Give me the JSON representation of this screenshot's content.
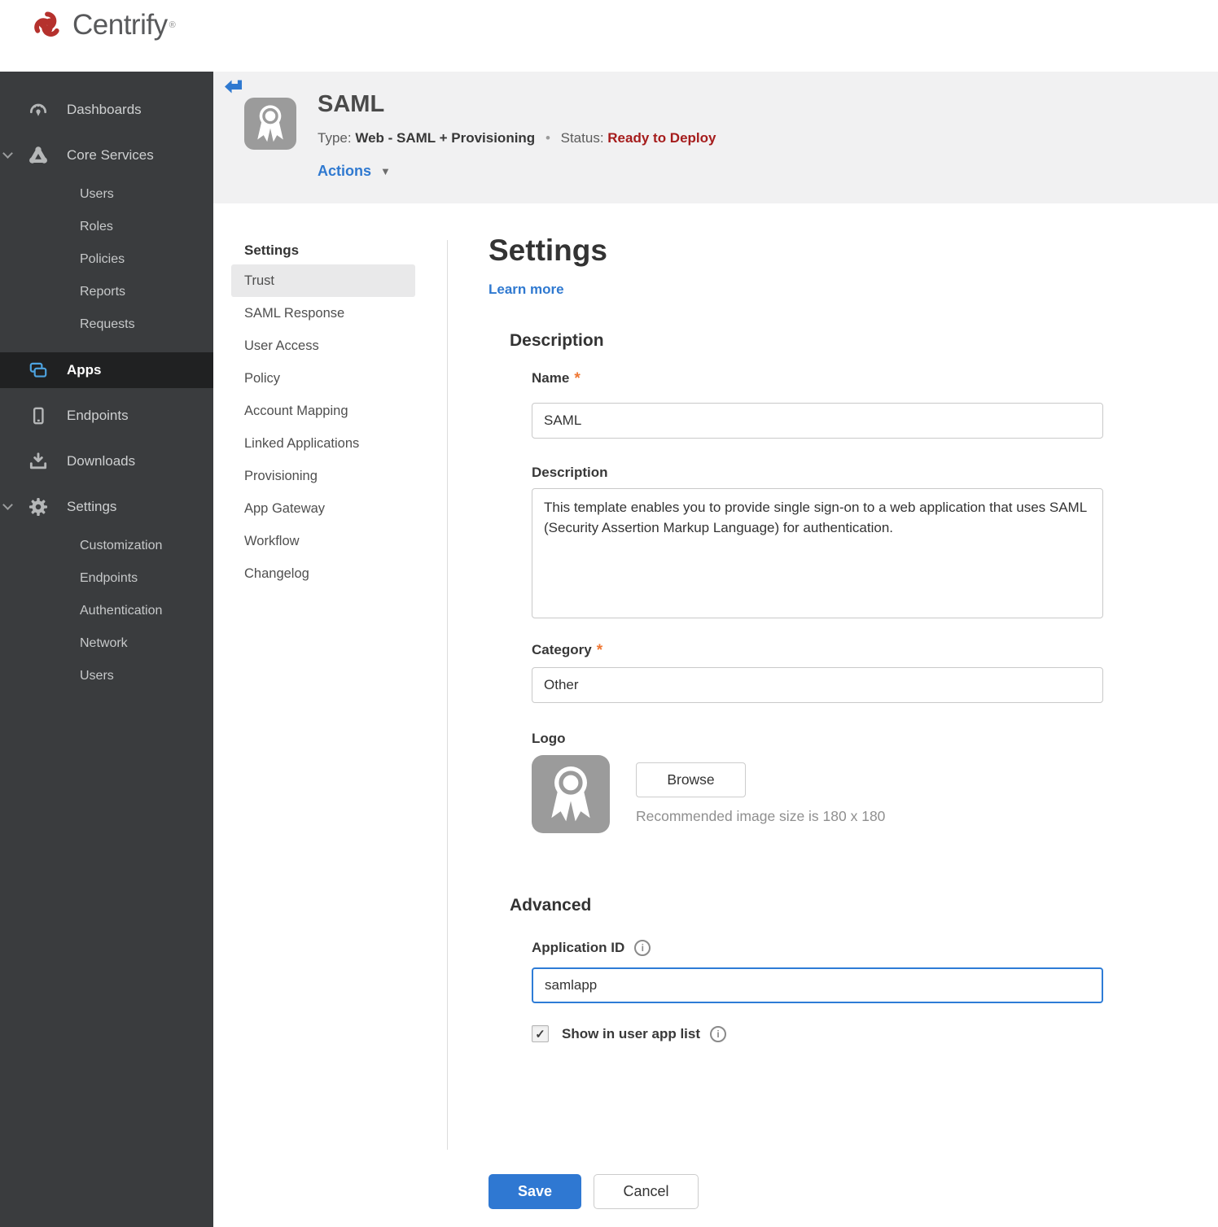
{
  "brand": {
    "name": "Centrify",
    "trademark": "®",
    "swirl_color": "#b5312d"
  },
  "icons": {
    "check": "✓",
    "dropdown_arrow": "▼",
    "separator_dot": "•",
    "required": "*",
    "info": "i"
  },
  "sidebar": {
    "items": [
      {
        "label": "Dashboards"
      },
      {
        "label": "Core Services",
        "expanded": true
      },
      {
        "label": "Users"
      },
      {
        "label": "Roles"
      },
      {
        "label": "Policies"
      },
      {
        "label": "Reports"
      },
      {
        "label": "Requests"
      },
      {
        "label": "Apps",
        "active": true
      },
      {
        "label": "Endpoints"
      },
      {
        "label": "Downloads"
      },
      {
        "label": "Settings",
        "expanded": true
      },
      {
        "label": "Customization"
      },
      {
        "label": "Endpoints"
      },
      {
        "label": "Authentication"
      },
      {
        "label": "Network"
      },
      {
        "label": "Users"
      }
    ]
  },
  "header": {
    "app_name": "SAML",
    "type_label": "Type:",
    "type_value": "Web - SAML + Provisioning",
    "status_label": "Status:",
    "status_value": "Ready to Deploy",
    "status_color": "#a51c1c",
    "actions_label": "Actions"
  },
  "subnav": {
    "title": "Settings",
    "active_item": "Trust",
    "items": [
      "Trust",
      "SAML Response",
      "User Access",
      "Policy",
      "Account Mapping",
      "Linked Applications",
      "Provisioning",
      "App Gateway",
      "Workflow",
      "Changelog"
    ]
  },
  "main": {
    "title": "Settings",
    "learn_more": "Learn more",
    "description_section": {
      "heading": "Description",
      "name_label": "Name",
      "name_value": "SAML",
      "description_label": "Description",
      "description_value": "This template enables you to provide single sign-on to a web application that uses SAML (Security Assertion Markup Language) for authentication.",
      "category_label": "Category",
      "category_value": "Other",
      "logo_label": "Logo",
      "browse_button": "Browse",
      "logo_hint": "Recommended image size is 180 x 180"
    },
    "advanced_section": {
      "heading": "Advanced",
      "application_id_label": "Application ID",
      "application_id_value": "samlapp",
      "checkbox_label": "Show in user app list",
      "checkbox_checked": true
    },
    "save_button": "Save",
    "cancel_button": "Cancel"
  }
}
